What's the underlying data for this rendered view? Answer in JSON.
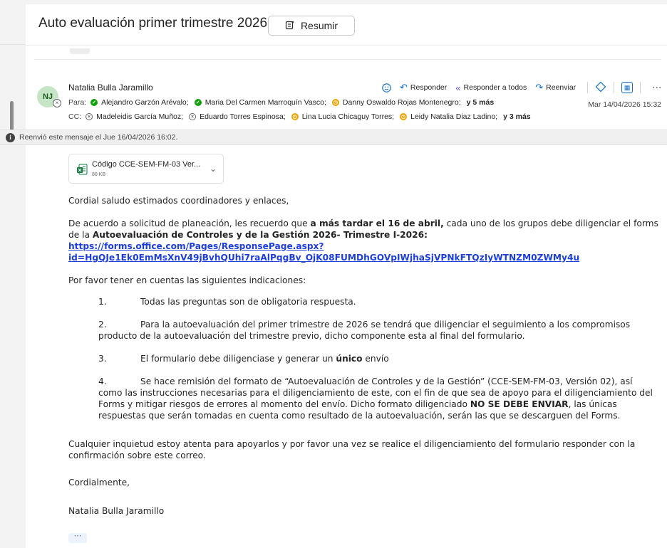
{
  "subject": "Auto evaluación primer trimestre 2026",
  "summarize_label": "Resumir",
  "sender": {
    "initials": "NJ",
    "name": "Natalia Bulla Jaramillo"
  },
  "actions": {
    "reply": "Responder",
    "reply_all": "Responder a todos",
    "forward": "Reenviar",
    "more": "⋯"
  },
  "to": {
    "label": "Para:",
    "recipients": [
      {
        "name": "Alejandro Garzón Arévalo;",
        "status": "available"
      },
      {
        "name": "Maria Del Carmen Marroquín Vasco;",
        "status": "available"
      },
      {
        "name": "Danny Oswaldo Rojas Montenegro;",
        "status": "away"
      }
    ],
    "more": "y 5 más"
  },
  "cc": {
    "label": "CC:",
    "recipients": [
      {
        "name": "Madeleidis García Muñoz;",
        "status": "offline"
      },
      {
        "name": "Eduardo Torres Espinosa;",
        "status": "offline"
      },
      {
        "name": "Lina Lucia Chicaguy Torres;",
        "status": "away"
      },
      {
        "name": "Leidy Natalia Diaz Ladino;",
        "status": "away"
      }
    ],
    "more": "y 3 más"
  },
  "date": "Mar 14/04/2026 15:32",
  "forward_notice": "Reenvió este mensaje el Jue 16/04/2026 16:02.",
  "attachment": {
    "name": "Código CCE-SEM-FM-03 Ver...",
    "size": "80 KB"
  },
  "body": {
    "greeting": "Cordial saludo estimados coordinadores y enlaces,",
    "p1_a": "De acuerdo a solicitud de planeación, les recuerdo que ",
    "p1_bold": "a más tardar el 16 de abril,",
    "p1_b": " cada uno de los grupos  debe diligenciar el forms de la ",
    "p1_bold2": "Autoevaluación de Controles y de la Gestión 2026- Trimestre I-2026:",
    "link_line1": "https://forms.office.com/Pages/ResponsePage.aspx?",
    "link_line2": "id=HgQJe1Ek0EmMsXnV49jBvhQUhi7raAlPqgBv_OjK08FUMDhGOVpIWjhaSjVPNkFTQzIyWTNZM0ZWMy4u",
    "intro": "Por favor tener en cuentas las siguientes indicaciones:",
    "item1_num": "1.",
    "item1": "Todas las preguntas son de obligatoria respuesta.",
    "item2_num": "2.",
    "item2": "Para la autoevaluación del primer trimestre de 2026 se tendrá que diligenciar el seguimiento a los compromisos producto de la autoevaluación del trimestre previo, dicho componente esta al final del formulario.",
    "item3_num": "3.",
    "item3_a": "El formulario debe diligenciase y generar un ",
    "item3_bold": "único",
    "item3_b": " envío",
    "item4_num": "4.",
    "item4_a": "Se hace remisión del formato de “Autoevaluación de Controles y de la Gestión” (CCE-SEM-FM-03, Versión 02), así como las instrucciones necesarias para el diligenciamiento de este, con el fin de que sea de apoyo para el diligenciamiento del Forms y mitigar riesgos de errores al momento del envío. Dicho formato diligenciado ",
    "item4_bold": "NO SE DEBE ENVIAR",
    "item4_b": ", las únicas respuestas que serán tomadas en cuenta como resultado de la autoevaluación, serán las que se descarguen del Forms.",
    "closing": "Cualquier inquietud estoy atenta para apoyarlos y por favor una vez se realice el diligenciamiento del formulario responder con la confirmación sobre este correo.",
    "signoff": "Cordialmente,",
    "signature": "Natalia Bulla Jaramillo"
  },
  "expand_dots": "⋯"
}
